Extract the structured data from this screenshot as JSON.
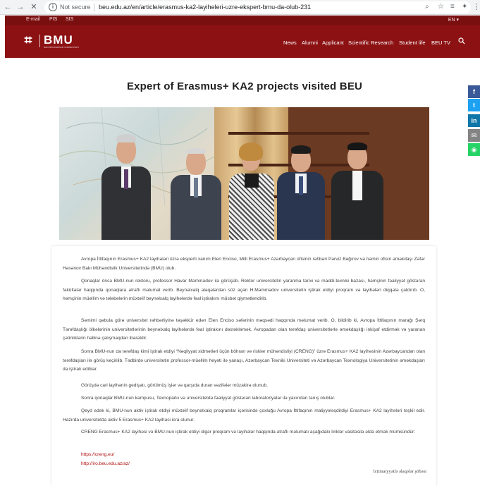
{
  "browser": {
    "security_label": "Not secure",
    "url": "beu.edu.az/en/article/erasmus-ka2-layiheleri-uzre-ekspert-bmu-da-olub-231"
  },
  "topbar": {
    "links": [
      "E-mail",
      "PIS",
      "SIS"
    ],
    "language": "EN ▾"
  },
  "header": {
    "logo_text": "BMU",
    "logo_subtitle": "BAKI MÜHƏNDİSLİK UNİVERSİTETİ",
    "nav": [
      "News",
      "Alumni",
      "Applicant",
      "Scientific Research",
      "Student life",
      "BEU TV"
    ]
  },
  "share": [
    {
      "icon": "facebook-icon",
      "glyph": "f",
      "color": "#3b5998"
    },
    {
      "icon": "twitter-icon",
      "glyph": "t",
      "color": "#1da1f2"
    },
    {
      "icon": "linkedin-icon",
      "glyph": "in",
      "color": "#0e76a8"
    },
    {
      "icon": "email-icon",
      "glyph": "✉",
      "color": "#848484"
    },
    {
      "icon": "whatsapp-icon",
      "glyph": "◉",
      "color": "#25d366"
    }
  ],
  "article": {
    "title": "Expert of Erasmus+ KA2 projects visited BEU",
    "paragraphs": [
      "Avropa İttifaqının Erasmus+ KA2 layihələri üzrə eksperti xanım Elen Enciso, Milli Erasmus+ Azərbaycan ofisinin rəhbəri Pərviz Bağırov və həmin ofisin əməkdaşı Zəfər Həsənov Bakı Mühəndislik Universitetində (BMU) olub.",
      "Qonaqlar öncə BMU-nun rektoru, professor Havar Məmmədov ilə görüşüb. Rektor universitetin yaranma tarixi və maddi-texniki bazası, həmçinin fəaliyyət göstərən fakültələr haqqında qonaqlara ətraflı məlumat verib. Beynəlxalq əlaqələrdən söz açan H.Məmmədov universitetin iştirak etdiyi proqram və layihələri diqqətə çatdırıb. O, həmçinin müəllim və tələbələrin müxtəlif beynəlxalq layihələrdə fəal iştirakını müsbət qiymətləndirib.",
      "Səmimi qəbula görə universitet rəhbərliyinə təşəkkür edən Elen Enciso səfərinin məqsədi haqqında məlumat verib. O, bildirib ki, Avropa İttifaqının marağı Şərq Tərəfdaşlığı ölkələrinin universitetlərinin beynəlxalq layihələrdə fəal iştirakını dəstəkləmək, Avropadan olan tərəfdaş universitetlərlə əməkdaşlığı inkişaf etdirmək və yaranan çətinliklərin həllinə çalışmaqdan ibarətdir.",
      "Sonra BMU-nun da tərəfdaş kimi iştirak etdiyi “Nəqliyyat xidmətləri üçün böhran və risklər mühəndisliyi (CRENG)” üzrə Erasmus+ KA2 layihəsinin Azərbaycandan olan tərəfdaşları ilə görüş keçirilib. Tədbirdə universitetin professor-müəllim heyəti ilə yanaşı, Azərbaycan Texniki Universiteti və Azərbaycan Texnologiya Universitetinin əməkdaşları da iştirak ediblər.",
      "Görüşdə cari layihənin gedişatı, görülmüş işlər və qarşıda duran vəzifələr müzakirə olunub.",
      "Sonra qonaqlar BMU-nun kampusu, Texnoparkı və universitetdə fəaliyyət göstərən laboratoriyalar ilə yaxından tanış olublar.",
      "Qeyd edək ki, BMU-nun aktiv iştirak etdiyi müxtəlif beynəlxalq proqramlar içərisində çoxluğu Avropa İttifaqının maliyyələşdirdiyi Erasmus+ KA2 layihələri təşkil edir. Hazırda universitetdə aktiv 5 Erasmus+ KA2 layihəsi icra olunur.",
      "CRENG Erasmus+ KA2 layihəsi və BMU-nun iştirak etdiyi digər proqram və layihələr haqqında ətraflı məlumatı aşağıdakı linklər vasitəsilə əldə etmək mümkündür:"
    ],
    "links": [
      "https://creng.eu/",
      "http://iro.beu.edu.az/az/"
    ],
    "signature": "İctimaiyyətlə əlaqələr şöbəsi"
  }
}
